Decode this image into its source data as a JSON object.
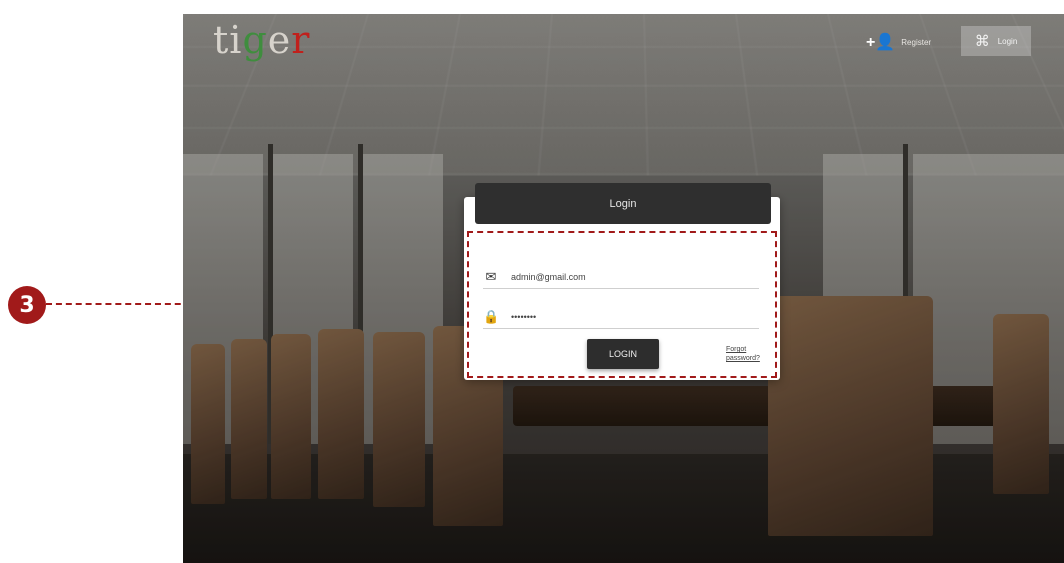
{
  "callout": {
    "number": "3"
  },
  "header": {
    "logo": {
      "t": "ti",
      "g": "g",
      "e": "e",
      "r": "r"
    },
    "register_label": "Register",
    "register_icon": "add-user-icon",
    "login_label": "Login",
    "login_icon": "login-icon"
  },
  "login_card": {
    "title": "Login",
    "email_value": "admin@gmail.com",
    "password_value": "••••••••",
    "email_icon": "envelope-icon",
    "password_icon": "lock-icon",
    "login_button": "LOGIN",
    "forgot_link": "Forgot password?"
  },
  "colors": {
    "accent": "#a11a1a",
    "header_bar": "#2f2f2f",
    "logo_green": "#3f8d3e",
    "logo_red": "#c0201c"
  }
}
